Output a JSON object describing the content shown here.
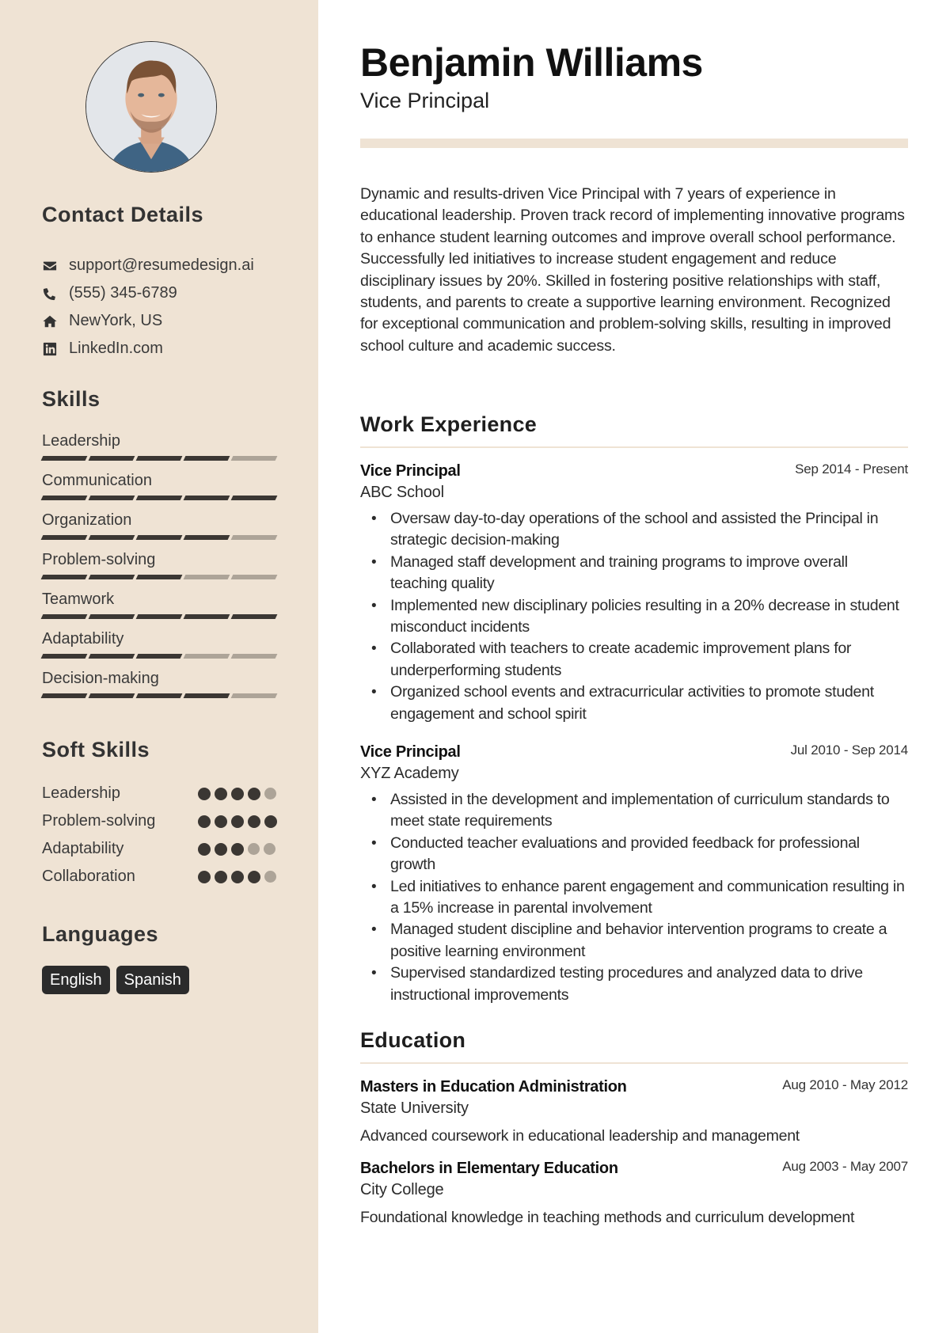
{
  "profile": {
    "name": "Benjamin Williams",
    "title": "Vice Principal",
    "photo_alt": "Profile photo"
  },
  "colors": {
    "sidebar_bg": "#EFE3D4",
    "accent": "#EFE3D4",
    "dark": "#3B3733",
    "muted": "#ADA498"
  },
  "contact": {
    "heading": "Contact Details",
    "items": [
      {
        "icon": "envelope-icon",
        "text": "support@resumedesign.ai"
      },
      {
        "icon": "phone-icon",
        "text": "(555) 345-6789"
      },
      {
        "icon": "home-icon",
        "text": "NewYork, US"
      },
      {
        "icon": "linkedin-icon",
        "text": "LinkedIn.com"
      }
    ]
  },
  "skills": {
    "heading": "Skills",
    "max": 5,
    "items": [
      {
        "label": "Leadership",
        "level": 4
      },
      {
        "label": "Communication",
        "level": 5
      },
      {
        "label": "Organization",
        "level": 4
      },
      {
        "label": "Problem-solving",
        "level": 3
      },
      {
        "label": "Teamwork",
        "level": 5
      },
      {
        "label": "Adaptability",
        "level": 3
      },
      {
        "label": "Decision-making",
        "level": 4
      }
    ]
  },
  "soft_skills": {
    "heading": "Soft Skills",
    "max": 5,
    "items": [
      {
        "label": "Leadership",
        "level": 4
      },
      {
        "label": "Problem-solving",
        "level": 5
      },
      {
        "label": "Adaptability",
        "level": 3
      },
      {
        "label": "Collaboration",
        "level": 4
      }
    ]
  },
  "languages": {
    "heading": "Languages",
    "items": [
      "English",
      "Spanish"
    ]
  },
  "summary": "Dynamic and results-driven Vice Principal with 7 years of experience in educational leadership. Proven track record of implementing innovative programs to enhance student learning outcomes and improve overall school performance. Successfully led initiatives to increase student engagement and reduce disciplinary issues by 20%. Skilled in fostering positive relationships with staff, students, and parents to create a supportive learning environment. Recognized for exceptional communication and problem-solving skills, resulting in improved school culture and academic success.",
  "work": {
    "heading": "Work Experience",
    "items": [
      {
        "role": "Vice Principal",
        "org": "ABC School",
        "dates": "Sep 2014 - Present",
        "bullets": [
          "Oversaw day-to-day operations of the school and assisted the Principal in strategic decision-making",
          "Managed staff development and training programs to improve overall teaching quality",
          "Implemented new disciplinary policies resulting in a 20% decrease in student misconduct incidents",
          "Collaborated with teachers to create academic improvement plans for underperforming students",
          "Organized school events and extracurricular activities to promote student engagement and school spirit"
        ]
      },
      {
        "role": "Vice Principal",
        "org": "XYZ Academy",
        "dates": "Jul 2010 - Sep 2014",
        "bullets": [
          "Assisted in the development and implementation of curriculum standards to meet state requirements",
          "Conducted teacher evaluations and provided feedback for professional growth",
          "Led initiatives to enhance parent engagement and communication resulting in a 15% increase in parental involvement",
          "Managed student discipline and behavior intervention programs to create a positive learning environment",
          "Supervised standardized testing procedures and analyzed data to drive instructional improvements"
        ]
      }
    ]
  },
  "education": {
    "heading": "Education",
    "items": [
      {
        "degree": "Masters in Education Administration",
        "school": "State University",
        "dates": "Aug 2010 - May 2012",
        "description": "Advanced coursework in educational leadership and management"
      },
      {
        "degree": "Bachelors in Elementary Education",
        "school": "City College",
        "dates": "Aug 2003 - May 2007",
        "description": "Foundational knowledge in teaching methods and curriculum development"
      }
    ]
  }
}
